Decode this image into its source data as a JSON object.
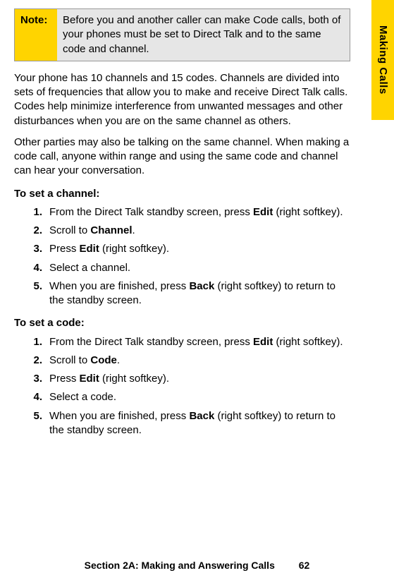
{
  "note": {
    "label": "Note:",
    "text": "Before you and another caller can make Code calls, both of your phones must be set to Direct Talk and to the same code and channel."
  },
  "para1": "Your phone has 10 channels and 15 codes. Channels are divided into sets of frequencies that allow you to make and receive Direct Talk calls. Codes help minimize interference from unwanted messages and other disturbances when you are on the same channel as others.",
  "para2": "Other parties may also be talking on the same channel. When making a code call, anyone within range and using the same code and channel can hear your conversation.",
  "channel": {
    "heading": "To set a channel:",
    "steps": [
      {
        "n": "1.",
        "pre": "From the Direct Talk standby screen, press ",
        "b": "Edit",
        "post": " (right softkey)."
      },
      {
        "n": "2.",
        "pre": "Scroll to ",
        "b": "Channel",
        "post": "."
      },
      {
        "n": "3.",
        "pre": "Press ",
        "b": "Edit",
        "post": " (right softkey)."
      },
      {
        "n": "4.",
        "pre": "Select a channel.",
        "b": "",
        "post": ""
      },
      {
        "n": "5.",
        "pre": "When you are finished, press ",
        "b": "Back",
        "post": " (right softkey) to return to the standby screen."
      }
    ]
  },
  "code": {
    "heading": "To set a code:",
    "steps": [
      {
        "n": "1.",
        "pre": "From the Direct Talk standby screen, press ",
        "b": "Edit",
        "post": " (right softkey)."
      },
      {
        "n": "2.",
        "pre": "Scroll to ",
        "b": "Code",
        "post": "."
      },
      {
        "n": "3.",
        "pre": "Press ",
        "b": "Edit",
        "post": " (right softkey)."
      },
      {
        "n": "4.",
        "pre": "Select a code.",
        "b": "",
        "post": ""
      },
      {
        "n": "5.",
        "pre": "When you are finished, press ",
        "b": "Back",
        "post": " (right softkey) to return to the standby screen."
      }
    ]
  },
  "sideTab": "Making Calls",
  "footer": {
    "section": "Section 2A: Making and Answering Calls",
    "page": "62"
  }
}
